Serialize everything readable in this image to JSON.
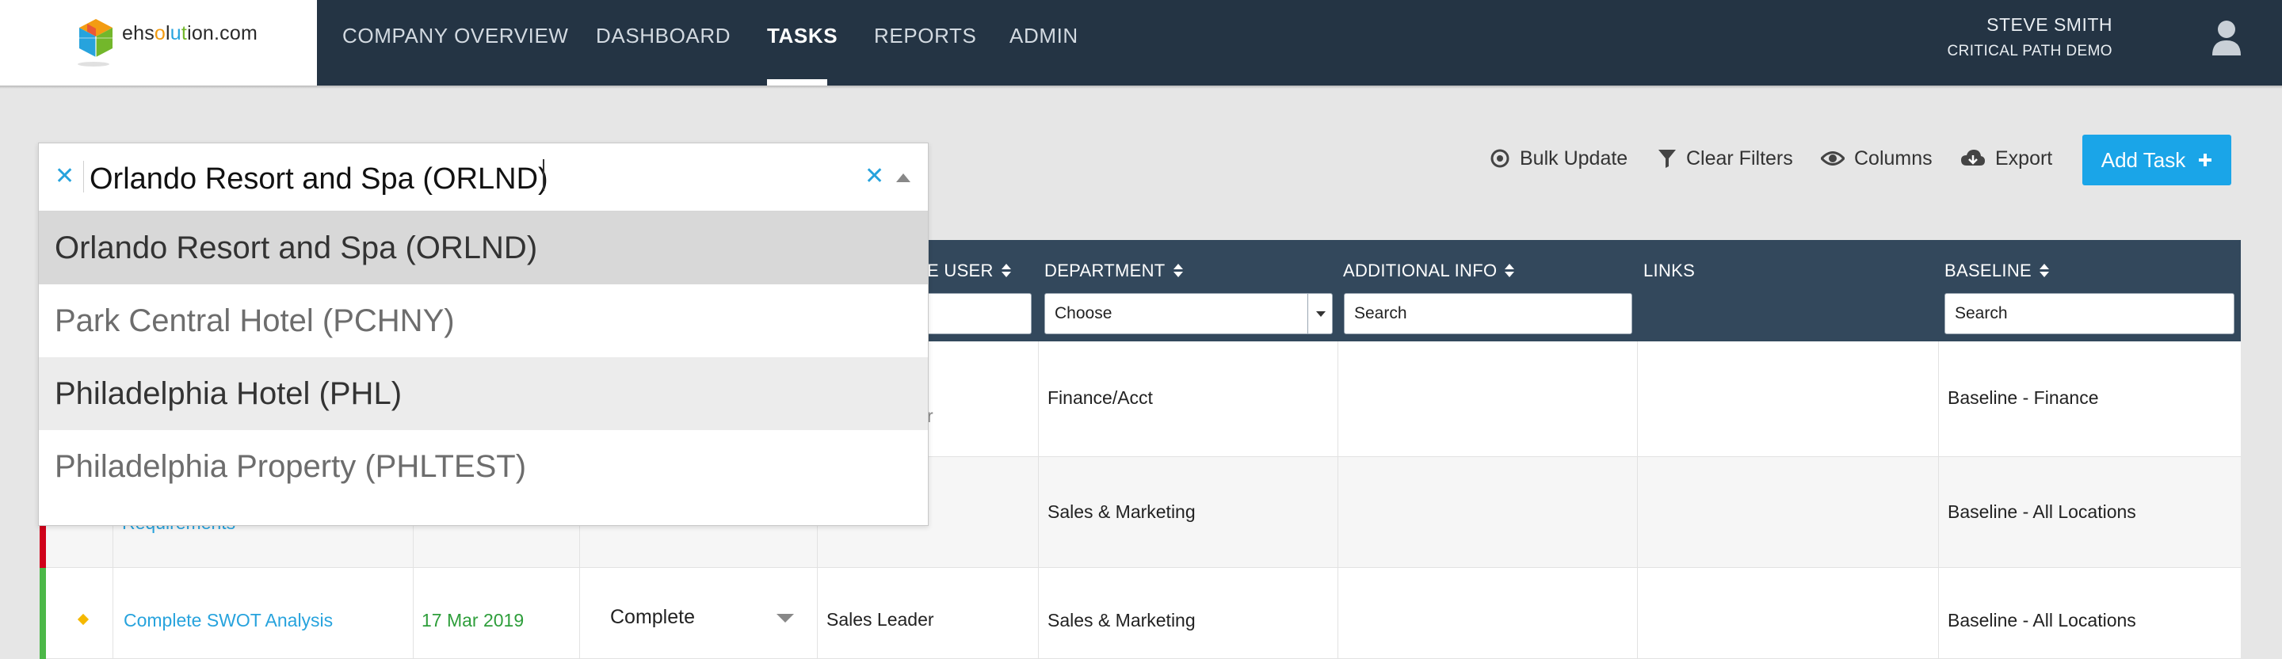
{
  "app": {
    "logo_text_prefix": "ehs",
    "logo_text_o": "o",
    "logo_text_l": "l",
    "logo_text_u": "u",
    "logo_text_t": "t",
    "logo_text_ion": "ion",
    "logo_text_suffix": ".com"
  },
  "nav": {
    "items": [
      "COMPANY OVERVIEW",
      "DASHBOARD",
      "TASKS",
      "REPORTS",
      "ADMIN"
    ],
    "active": "TASKS"
  },
  "user": {
    "name": "STEVE SMITH",
    "subtitle": "CRITICAL PATH DEMO"
  },
  "toolbar": {
    "bulk_update": "Bulk Update",
    "clear_filters": "Clear Filters",
    "columns": "Columns",
    "export": "Export",
    "add_task": "Add Task"
  },
  "location_select": {
    "value": "Orlando Resort and Spa (ORLND)",
    "options": [
      "Orlando Resort and Spa (ORLND)",
      "Park Central Hotel (PCHNY)",
      "Philadelphia Hotel (PHL)",
      "Philadelphia Property (PHLTEST)"
    ],
    "selected_index": 0,
    "hover_index": 2
  },
  "table": {
    "headers": {
      "responsible_user_partial": "E USER",
      "department": "DEPARTMENT",
      "additional_info": "ADDITIONAL INFO",
      "links": "LINKS",
      "baseline": "BASELINE"
    },
    "filters": {
      "department_placeholder": "Choose",
      "additional_info_placeholder": "Search",
      "baseline_placeholder": "Search"
    },
    "rows": [
      {
        "task_fragment": "",
        "user_fragment": "r",
        "department": "Finance/Acct",
        "baseline": "Baseline - Finance",
        "status_color": ""
      },
      {
        "task_fragment": "Requirements",
        "department": "Sales & Marketing",
        "baseline": "Baseline - All Locations",
        "status_color": "#d0021b"
      },
      {
        "task": "Complete SWOT Analysis",
        "date": "17 Mar 2019",
        "status": "Complete",
        "user": "Sales Leader",
        "department": "Sales & Marketing",
        "baseline": "Baseline - All Locations",
        "status_color": "#4cb848"
      }
    ]
  },
  "colors": {
    "nav_bg": "#243444",
    "table_header_bg": "#33485c",
    "accent": "#1aa5e8",
    "link": "#27a3dd",
    "date_green": "#2e9e3b"
  }
}
